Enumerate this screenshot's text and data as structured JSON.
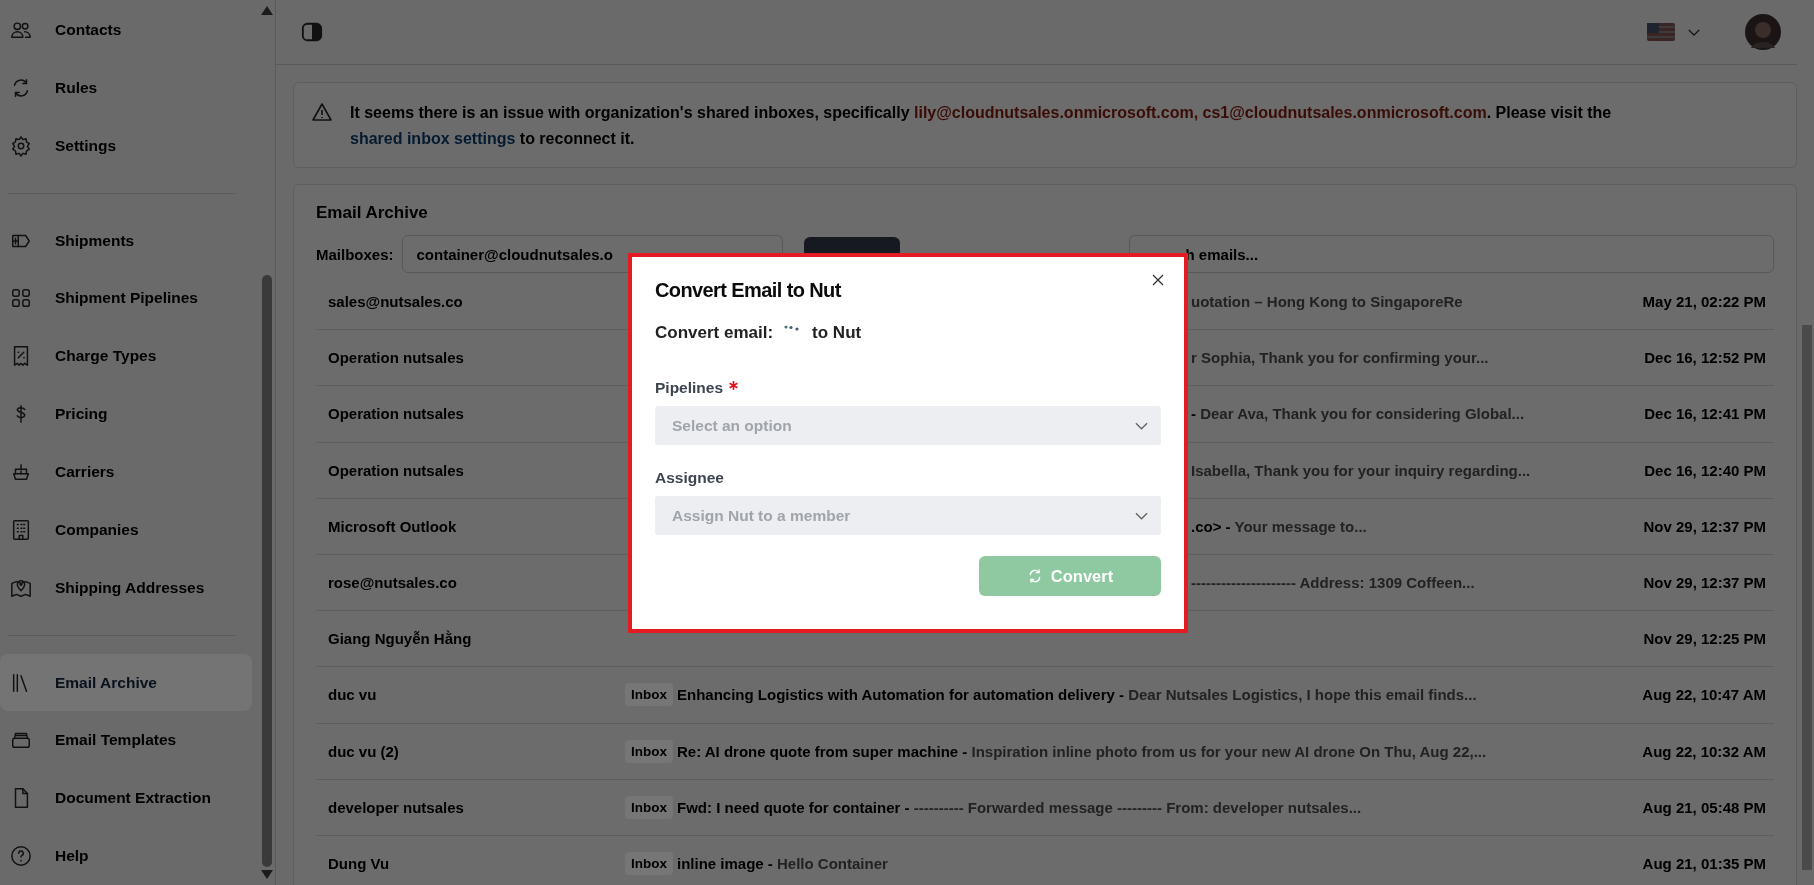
{
  "sidebar": {
    "items": [
      {
        "label": "Contacts",
        "selected": false
      },
      {
        "label": "Rules",
        "selected": false
      },
      {
        "label": "Settings",
        "selected": false
      },
      {
        "label": "Shipments",
        "selected": false
      },
      {
        "label": "Shipment Pipelines",
        "selected": false
      },
      {
        "label": "Charge Types",
        "selected": false
      },
      {
        "label": "Pricing",
        "selected": false
      },
      {
        "label": "Carriers",
        "selected": false
      },
      {
        "label": "Companies",
        "selected": false
      },
      {
        "label": "Shipping Addresses",
        "selected": false
      },
      {
        "label": "Email Archive",
        "selected": true
      },
      {
        "label": "Email Templates",
        "selected": false
      },
      {
        "label": "Document Extraction",
        "selected": false
      },
      {
        "label": "Help",
        "selected": false
      }
    ]
  },
  "banner": {
    "parts": [
      {
        "kind": "text",
        "text": "It seems there is an issue with organization's shared inboxes, specifically "
      },
      {
        "kind": "email",
        "text": "lily@cloudnutsales.onmicrosoft.com, cs1@cloudnutsales.onmicrosoft.com"
      },
      {
        "kind": "text",
        "text": ". Please visit the "
      },
      {
        "kind": "link",
        "text": "shared inbox settings"
      },
      {
        "kind": "text",
        "text": " to reconnect it."
      }
    ]
  },
  "archive": {
    "title": "Email Archive",
    "mailbox_label": "Mailboxes:",
    "mailbox_value": "container@cloudnutsales.o",
    "search": {
      "placeholder": "h emails..."
    },
    "rows": [
      {
        "sender": "sales@nutsales.co",
        "preview": "uotation – Hong Kong to SingaporeRe",
        "date": "May 21, 02:22 PM"
      },
      {
        "sender": "Operation nutsales",
        "preview": "r Sophia, Thank you for confirming your...",
        "date": "Dec 16, 12:52 PM"
      },
      {
        "sender": "Operation nutsales",
        "subject": "- ",
        "preview": "Dear Ava, Thank you for considering Global...",
        "date": "Dec 16, 12:41 PM"
      },
      {
        "sender": "Operation nutsales",
        "preview": "Isabella, Thank you for your inquiry regarding...",
        "date": "Dec 16, 12:40 PM"
      },
      {
        "sender": "Microsoft Outlook",
        "subject": ".co> - ",
        "preview": "Your message to...",
        "date": "Nov 29, 12:37 PM"
      },
      {
        "sender": "rose@nutsales.co",
        "preview": "--------------------- Address: 1309 Coffeen...",
        "date": "Nov 29, 12:37 PM"
      },
      {
        "sender": "Giang Nguyễn Hằng",
        "date": "Nov 29, 12:25 PM"
      },
      {
        "sender": "duc vu",
        "folder": "Inbox",
        "subject": "Enhancing Logistics with Automation for automation delivery - ",
        "preview": "Dear Nutsales Logistics, I hope this email finds...",
        "date": "Aug 22, 10:47 AM"
      },
      {
        "sender": "duc vu (2)",
        "folder": "Inbox",
        "subject": "Re: AI drone quote from super machine - ",
        "preview": "Inspiration inline photo from us for your new AI drone On Thu, Aug 22,...",
        "date": "Aug 22, 10:32 AM"
      },
      {
        "sender": "developer nutsales",
        "folder": "Inbox",
        "subject": "Fwd: I need quote for container - ",
        "preview": "---------- Forwarded message --------- From: developer nutsales...",
        "date": "Aug 21, 05:48 PM"
      },
      {
        "sender": "Dung Vu",
        "folder": "Inbox",
        "subject": "inline image - ",
        "preview": "Hello Container",
        "date": "Aug 21, 01:35 PM"
      }
    ]
  },
  "modal": {
    "title": "Convert Email to Nut",
    "prompt_start": "Convert email:",
    "prompt_end": "to Nut",
    "fields": [
      {
        "label": "Pipelines",
        "required": true,
        "placeholder": "Select an option"
      },
      {
        "label": "Assignee",
        "required": false,
        "placeholder": "Assign Nut to a member"
      }
    ],
    "submit": {
      "label": "Convert",
      "disabled": true
    }
  }
}
